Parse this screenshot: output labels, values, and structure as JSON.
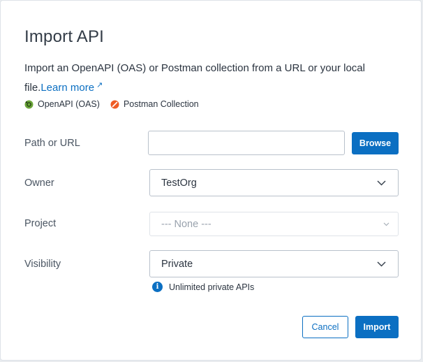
{
  "dialog": {
    "title": "Import API",
    "description_text": "Import an OpenAPI (OAS) or Postman collection from a URL or your local file.",
    "learn_more": "Learn more"
  },
  "formats": [
    {
      "label": "OpenAPI (OAS)",
      "icon": "openapi-icon",
      "color": "#6ba539"
    },
    {
      "label": "Postman Collection",
      "icon": "postman-icon",
      "color": "#ef5b25"
    }
  ],
  "form": {
    "path": {
      "label": "Path or URL",
      "value": "",
      "browse_label": "Browse"
    },
    "owner": {
      "label": "Owner",
      "selected": "TestOrg"
    },
    "project": {
      "label": "Project",
      "selected": "--- None ---"
    },
    "visibility": {
      "label": "Visibility",
      "selected": "Private",
      "hint": "Unlimited private APIs"
    }
  },
  "actions": {
    "cancel": "Cancel",
    "import": "Import"
  },
  "colors": {
    "accent": "#0b6fc2"
  }
}
